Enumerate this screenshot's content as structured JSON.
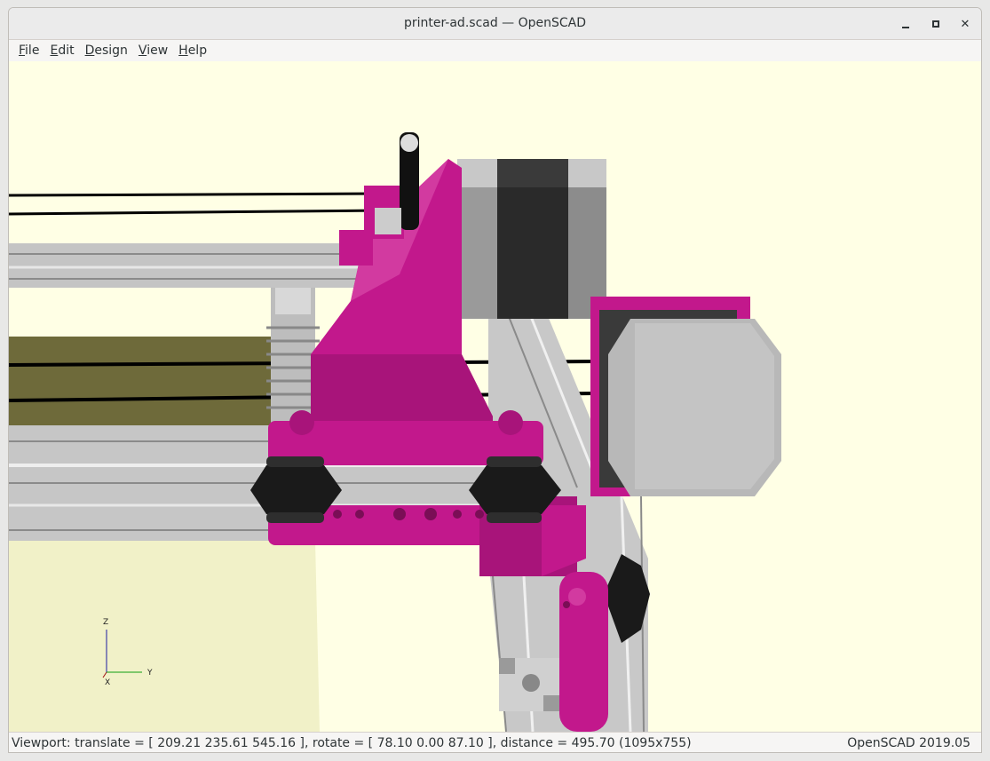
{
  "window": {
    "title": "printer-ad.scad — OpenSCAD"
  },
  "menu": [
    {
      "label": "File",
      "mnemonic": "F",
      "rest": "ile"
    },
    {
      "label": "Edit",
      "mnemonic": "E",
      "rest": "dit"
    },
    {
      "label": "Design",
      "mnemonic": "D",
      "rest": "esign"
    },
    {
      "label": "View",
      "mnemonic": "V",
      "rest": "iew"
    },
    {
      "label": "Help",
      "mnemonic": "H",
      "rest": "elp"
    }
  ],
  "axes": {
    "z": "Z",
    "y": "Y",
    "x": "X"
  },
  "status": {
    "viewport": "Viewport: translate = [ 209.21 235.61 545.16 ], rotate = [ 78.10 0.00 87.10 ], distance = 495.70 (1095x755)",
    "version": "OpenSCAD 2019.05"
  },
  "colors": {
    "background": "#ffffe5",
    "part_magenta": "#c2188c",
    "extrusion_gray": "#c8c8c8",
    "motor_dark": "#2a2a2a",
    "wheel_black": "#1a1a1a"
  }
}
